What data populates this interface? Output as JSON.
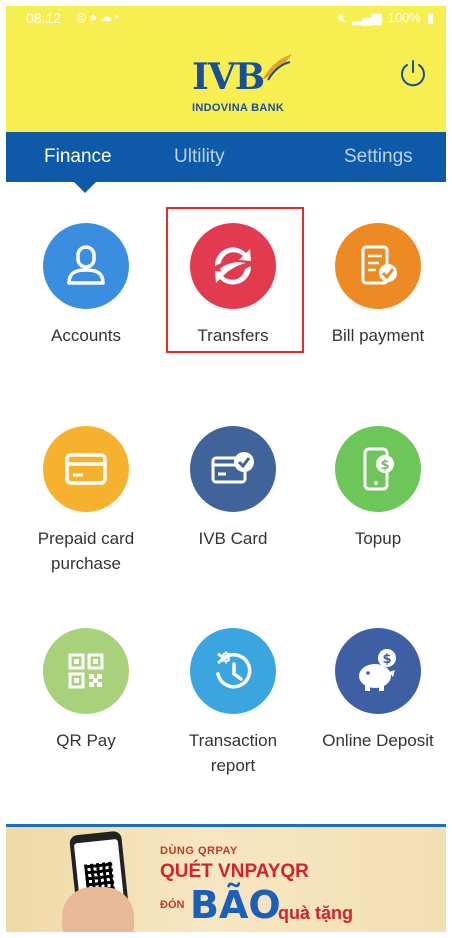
{
  "status_bar": {
    "time": "08:12",
    "left_icons": [
      "voicemail-icon",
      "app-badge-icon",
      "cloud-icon",
      "dot-icon"
    ],
    "battery": "100%"
  },
  "header": {
    "logo_text": "IVB",
    "logo_subtitle": "INDOVINA BANK",
    "background_color": "#f7ef52",
    "brand_color": "#1a4f9c"
  },
  "tabs": [
    {
      "label": "Finance",
      "active": true
    },
    {
      "label": "Ultility",
      "active": false
    },
    {
      "label": "Settings",
      "active": false
    }
  ],
  "menu": [
    {
      "label": "Accounts",
      "icon": "user-icon"
    },
    {
      "label": "Transfers",
      "icon": "transfer-icon",
      "highlighted": true
    },
    {
      "label": "Bill payment",
      "icon": "bill-check-icon"
    },
    {
      "label_line1": "Prepaid card",
      "label_line2": "purchase",
      "icon": "card-icon"
    },
    {
      "label": "IVB Card",
      "icon": "card-check-icon"
    },
    {
      "label": "Topup",
      "icon": "phone-dollar-icon"
    },
    {
      "label": "QR Pay",
      "icon": "qr-icon"
    },
    {
      "label_line1": "Transaction",
      "label_line2": "report",
      "icon": "dollar-clock-icon"
    },
    {
      "label": "Online Deposit",
      "icon": "piggy-bank-icon"
    }
  ],
  "banner": {
    "line1": "DÙNG QRPAY",
    "line2": "QUÉT VNPAYQR",
    "line3": "ĐÓN",
    "line4": "BÃO",
    "line5": "quà tặng"
  }
}
